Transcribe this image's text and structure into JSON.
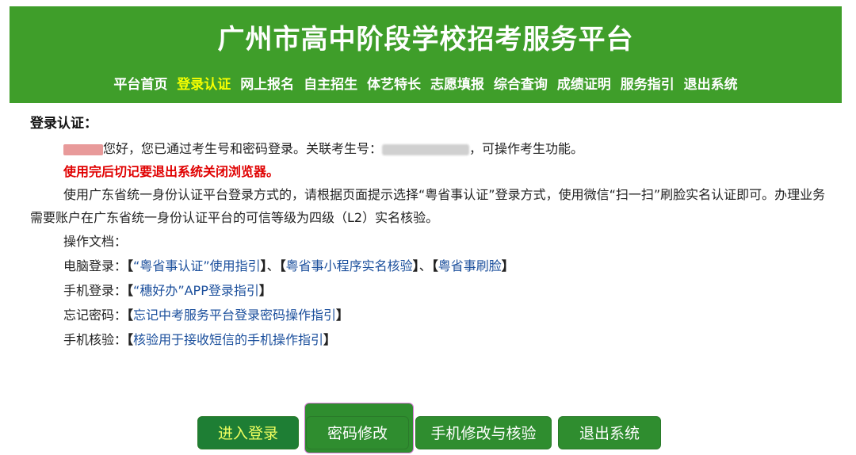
{
  "header": {
    "title": "广州市高中阶段学校招考服务平台",
    "nav": [
      {
        "label": "平台首页",
        "active": false
      },
      {
        "label": "登录认证",
        "active": true
      },
      {
        "label": "网上报名",
        "active": false
      },
      {
        "label": "自主招生",
        "active": false
      },
      {
        "label": "体艺特长",
        "active": false
      },
      {
        "label": "志愿填报",
        "active": false
      },
      {
        "label": "综合查询",
        "active": false
      },
      {
        "label": "成绩证明",
        "active": false
      },
      {
        "label": "服务指引",
        "active": false
      },
      {
        "label": "退出系统",
        "active": false
      }
    ],
    "bg_color": "#3f9e2a",
    "active_color": "#f6ff00"
  },
  "content": {
    "section_title": "登录认证：",
    "greeting_suffix": "您好，您已通过考生号和密码登录。关联考生号：",
    "greeting_tail": "，可操作考生功能。",
    "warning": "使用完后切记要退出系统关闭浏览器。",
    "notice": "使用广东省统一身份认证平台登录方式的，请根据页面提示选择“粤省事认证”登录方式，使用微信“扫一扫”刷脸实名认证即可。办理业务需要账户在广东省统一身份认证平台的可信等级为四级（L2）实名核验。",
    "docs_heading": "操作文档：",
    "docs": {
      "pc_label": "电脑登录：",
      "pc_links": [
        "“粤省事认证”使用指引",
        "粤省事小程序实名核验",
        "粤省事刷脸"
      ],
      "separator": "、",
      "mobile_label": "手机登录：",
      "mobile_link": "“穗好办”APP登录指引",
      "forgot_label": "忘记密码：",
      "forgot_link": "忘记中考服务平台登录密码操作指引",
      "phone_label": "手机核验：",
      "phone_link": "核验用于接收短信的手机操作指引"
    },
    "bracket_open": "【",
    "bracket_close": "】"
  },
  "buttons": {
    "login": "进入登录",
    "change_password": "密码修改",
    "change_phone": "手机修改与核验",
    "logout": "退出系统"
  }
}
